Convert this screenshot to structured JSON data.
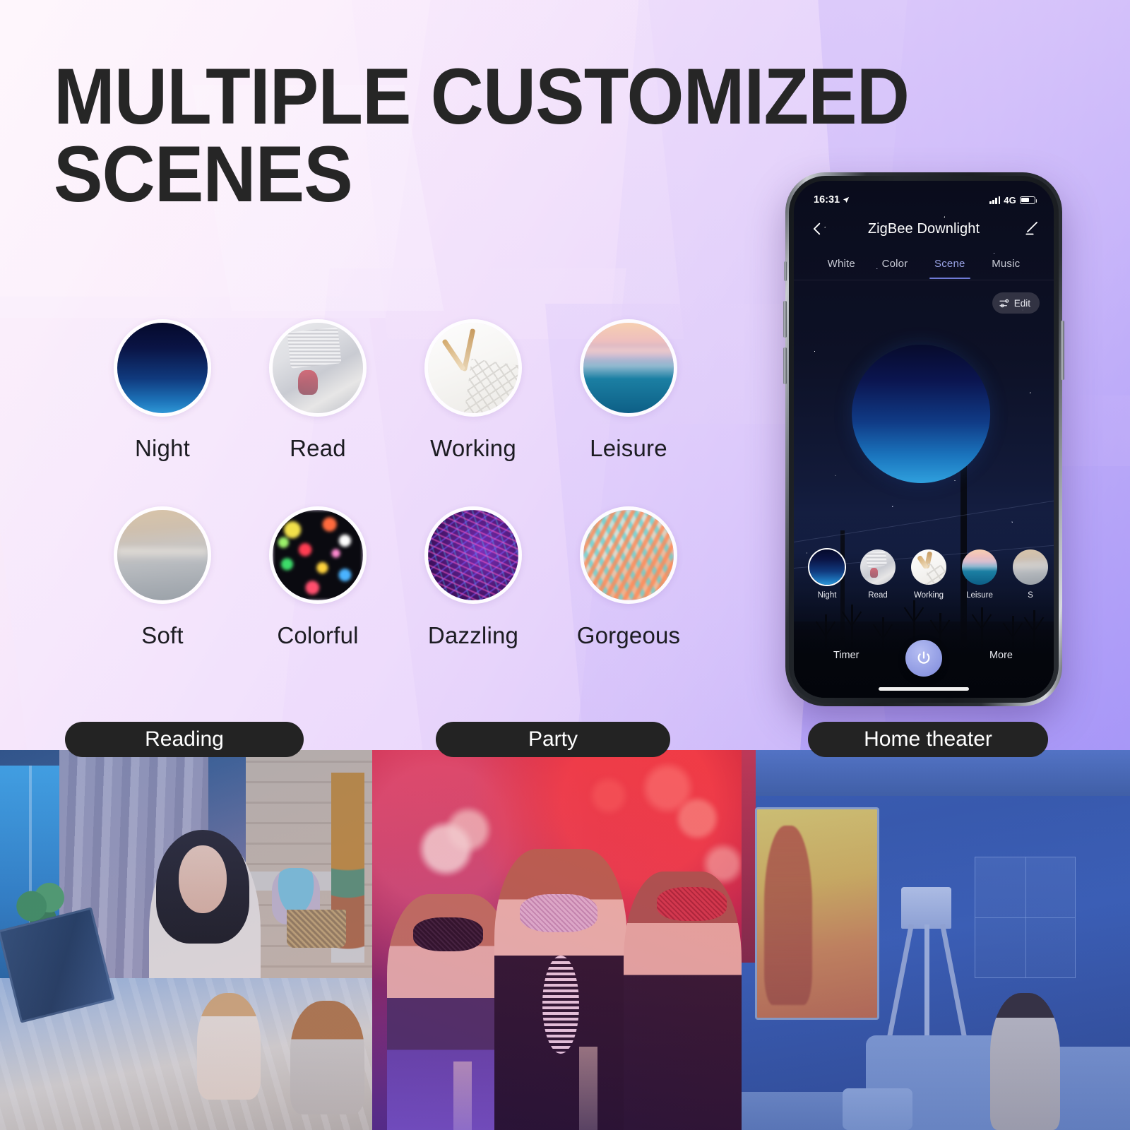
{
  "headline": "MULTIPLE CUSTOMIZED\nSCENES",
  "background": {
    "gradient_from": "#fdf4fb",
    "gradient_to": "#9a8cf6"
  },
  "scene_grid": {
    "items": [
      {
        "label": "Night",
        "art": "art-night",
        "icon": "scene-thumb-night"
      },
      {
        "label": "Read",
        "art": "art-read",
        "icon": "scene-thumb-read"
      },
      {
        "label": "Working",
        "art": "art-working",
        "icon": "scene-thumb-working"
      },
      {
        "label": "Leisure",
        "art": "art-leisure",
        "icon": "scene-thumb-leisure"
      },
      {
        "label": "Soft",
        "art": "art-soft",
        "icon": "scene-thumb-soft"
      },
      {
        "label": "Colorful",
        "art": "art-colorful",
        "icon": "scene-thumb-colorful"
      },
      {
        "label": "Dazzling",
        "art": "art-dazzling",
        "icon": "scene-thumb-dazzling"
      },
      {
        "label": "Gorgeous",
        "art": "art-gorgeous",
        "icon": "scene-thumb-gorgeous"
      }
    ]
  },
  "phone": {
    "status_bar": {
      "time": "16:31",
      "location_icon": "location-arrow-icon",
      "signal_icon": "signal-bars-icon",
      "network": "4G",
      "battery_icon": "battery-icon"
    },
    "nav": {
      "back_icon": "chevron-left-icon",
      "title": "ZigBee Downlight",
      "edit_icon": "pencil-icon"
    },
    "tabs": [
      {
        "label": "White",
        "active": false
      },
      {
        "label": "Color",
        "active": false
      },
      {
        "label": "Scene",
        "active": true
      },
      {
        "label": "Music",
        "active": false
      }
    ],
    "active_tab_color": "#9aa3e6",
    "edit_button": {
      "label": "Edit",
      "icon": "sliders-icon"
    },
    "carousel": [
      {
        "label": "Night",
        "art": "art-night",
        "selected": true
      },
      {
        "label": "Read",
        "art": "art-read",
        "selected": false
      },
      {
        "label": "Working",
        "art": "art-working",
        "selected": false
      },
      {
        "label": "Leisure",
        "art": "art-leisure",
        "selected": false
      },
      {
        "label": "S",
        "art": "art-soft",
        "selected": false
      }
    ],
    "bottom_bar": {
      "timer_label": "Timer",
      "power_icon": "power-icon",
      "power_color": "#8e99e2",
      "more_label": "More"
    }
  },
  "photo_strip": [
    {
      "label": "Reading"
    },
    {
      "label": "Party"
    },
    {
      "label": "Home theater"
    }
  ]
}
